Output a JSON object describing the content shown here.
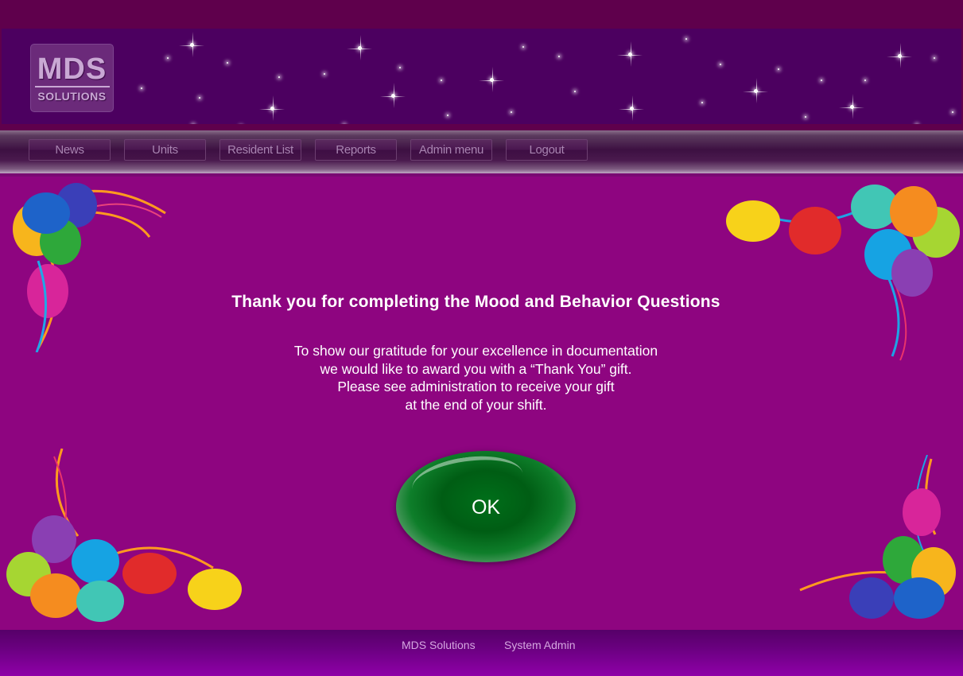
{
  "logo": {
    "title": "MDS",
    "subtitle": "SOLUTIONS"
  },
  "nav": {
    "items": [
      {
        "label": "News"
      },
      {
        "label": "Units"
      },
      {
        "label": "Resident List"
      },
      {
        "label": "Reports"
      },
      {
        "label": "Admin menu"
      },
      {
        "label": "Logout"
      }
    ]
  },
  "main": {
    "title": "Thank you for completing the Mood and Behavior Questions",
    "message_lines": [
      "To show our gratitude for your excellence in documentation",
      "we would like to award you with a “Thank You” gift.",
      "Please see administration to receive your gift",
      "at the end of your shift."
    ],
    "ok_label": "OK"
  },
  "footer": {
    "links": [
      {
        "label": "MDS Solutions"
      },
      {
        "label": "System Admin"
      }
    ]
  },
  "colors": {
    "background": "#8e0580",
    "banner": "#4c0060",
    "ok_button": "#005d14",
    "text": "#ffffff"
  },
  "decorations": [
    "balloons-top-left",
    "balloons-top-right",
    "balloons-bottom-left",
    "balloons-bottom-right"
  ]
}
